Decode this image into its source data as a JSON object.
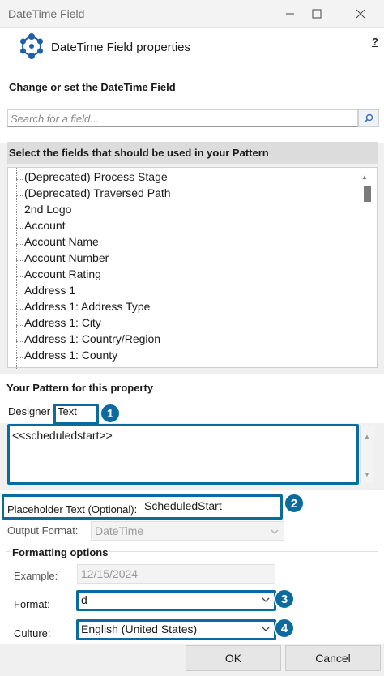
{
  "window": {
    "title": "DateTime Field"
  },
  "header": {
    "title": "DateTime Field properties",
    "help": "?"
  },
  "change_section": {
    "title": "Change or set the DateTime Field"
  },
  "search": {
    "placeholder": "Search for a field..."
  },
  "fields_section": {
    "title": "Select the fields that should be used in your Pattern",
    "items": [
      "(Deprecated) Process Stage",
      "(Deprecated) Traversed Path",
      "2nd Logo",
      "Account",
      "Account Name",
      "Account Number",
      "Account Rating",
      "Address 1",
      "Address 1: Address Type",
      "Address 1: City",
      "Address 1: Country/Region",
      "Address 1: County"
    ]
  },
  "pattern_section": {
    "title": "Your Pattern for this property",
    "tabs": [
      "Designer",
      "Text"
    ],
    "active_tab": "Text",
    "text_value": "<<scheduledstart>>"
  },
  "placeholder_field": {
    "label": "Placeholder Text (Optional):",
    "value": "ScheduledStart"
  },
  "output_format": {
    "label": "Output Format:",
    "value": "DateTime"
  },
  "formatting": {
    "title": "Formatting options",
    "example_label": "Example:",
    "example_value": "12/15/2024",
    "format_label": "Format:",
    "format_value": "d",
    "culture_label": "Culture:",
    "culture_value": "English (United States)"
  },
  "callouts": [
    "1",
    "2",
    "3",
    "4"
  ],
  "buttons": {
    "ok": "OK",
    "cancel": "Cancel"
  },
  "colors": {
    "callout": "#0b6b9e",
    "header_band": "#dcdcdc",
    "logo": "#1f5fa8"
  }
}
